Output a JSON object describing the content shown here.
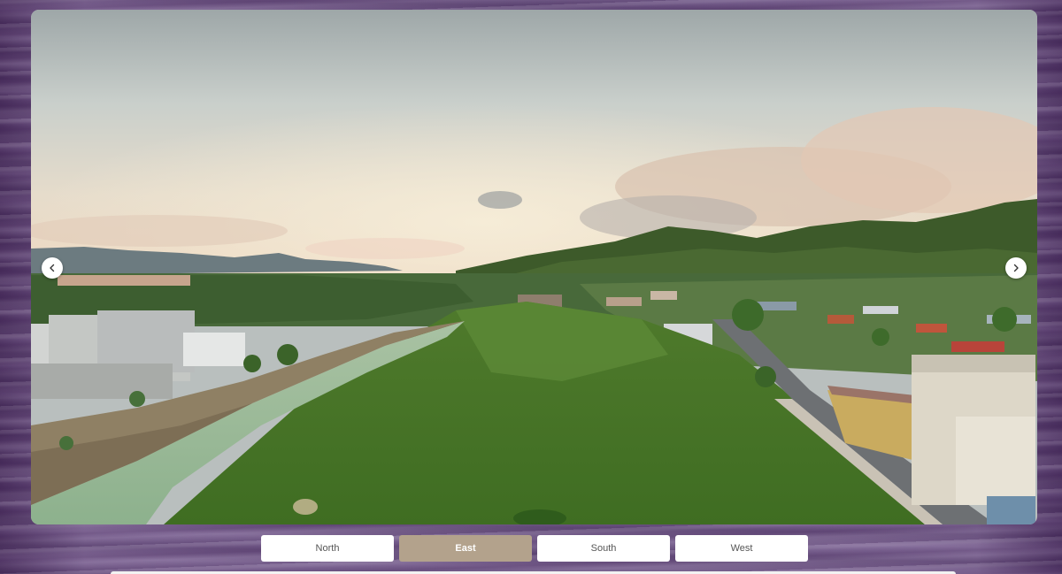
{
  "viewer": {
    "image_description_icon": "panorama-image",
    "prev_icon": "chevron-left-icon",
    "next_icon": "chevron-right-icon"
  },
  "direction_tabs": [
    {
      "label": "North",
      "active": false
    },
    {
      "label": "East",
      "active": true
    },
    {
      "label": "South",
      "active": false
    },
    {
      "label": "West",
      "active": false
    }
  ],
  "colors": {
    "active_tab": "#b3a28c",
    "tab": "#ffffff",
    "background": "#6d5584"
  }
}
